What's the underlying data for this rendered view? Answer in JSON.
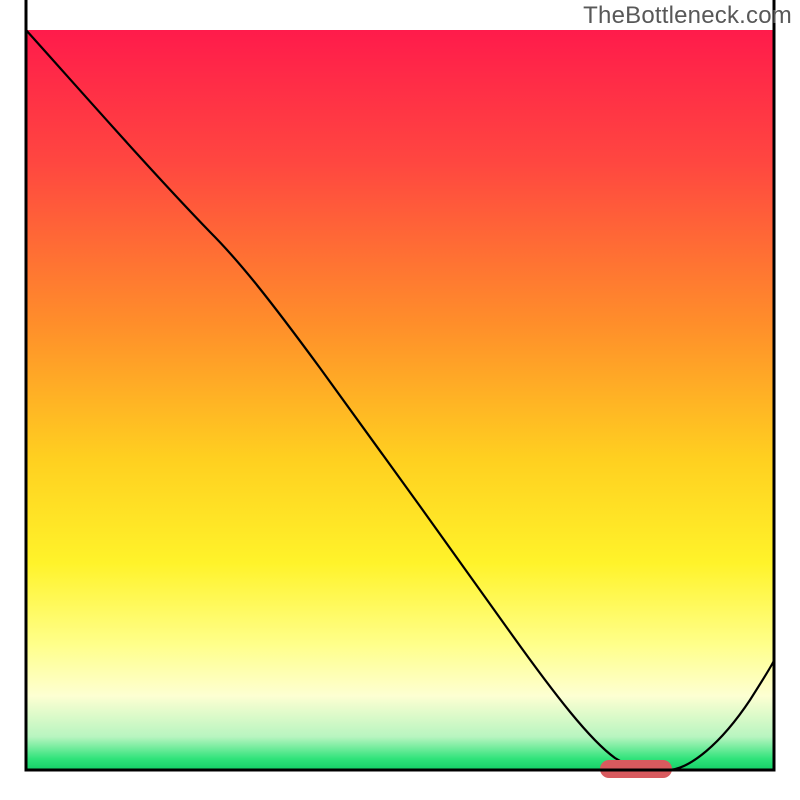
{
  "watermark": "TheBottleneck.com",
  "chart_data": {
    "type": "line",
    "title": "",
    "xlabel": "",
    "ylabel": "",
    "xlim": [
      0,
      100
    ],
    "ylim": [
      0,
      100
    ],
    "grid": false,
    "series": [
      {
        "name": "bottleneck-curve",
        "x": [
          0,
          5,
          10,
          15,
          20,
          25,
          30,
          35,
          40,
          45,
          50,
          55,
          60,
          65,
          70,
          75,
          80,
          82,
          85,
          90,
          95,
          100
        ],
        "y": [
          100,
          94,
          88,
          82,
          76,
          69,
          60,
          52,
          44,
          36,
          28,
          20,
          13,
          7,
          3,
          1,
          0,
          0,
          1,
          5,
          11,
          18
        ]
      }
    ],
    "annotations": [
      {
        "name": "marker-bar",
        "x_start": 76,
        "x_end": 84,
        "y": 0,
        "color": "#d85a5e"
      }
    ],
    "gradient_stops": [
      {
        "pos": 0.0,
        "color": "#ff1b4b"
      },
      {
        "pos": 0.18,
        "color": "#ff4740"
      },
      {
        "pos": 0.4,
        "color": "#ff8f2a"
      },
      {
        "pos": 0.58,
        "color": "#ffd020"
      },
      {
        "pos": 0.72,
        "color": "#fff32a"
      },
      {
        "pos": 0.83,
        "color": "#ffff8a"
      },
      {
        "pos": 0.9,
        "color": "#fdffd2"
      },
      {
        "pos": 0.955,
        "color": "#b8f5c0"
      },
      {
        "pos": 0.985,
        "color": "#2fe37a"
      },
      {
        "pos": 1.0,
        "color": "#14cf67"
      }
    ]
  }
}
